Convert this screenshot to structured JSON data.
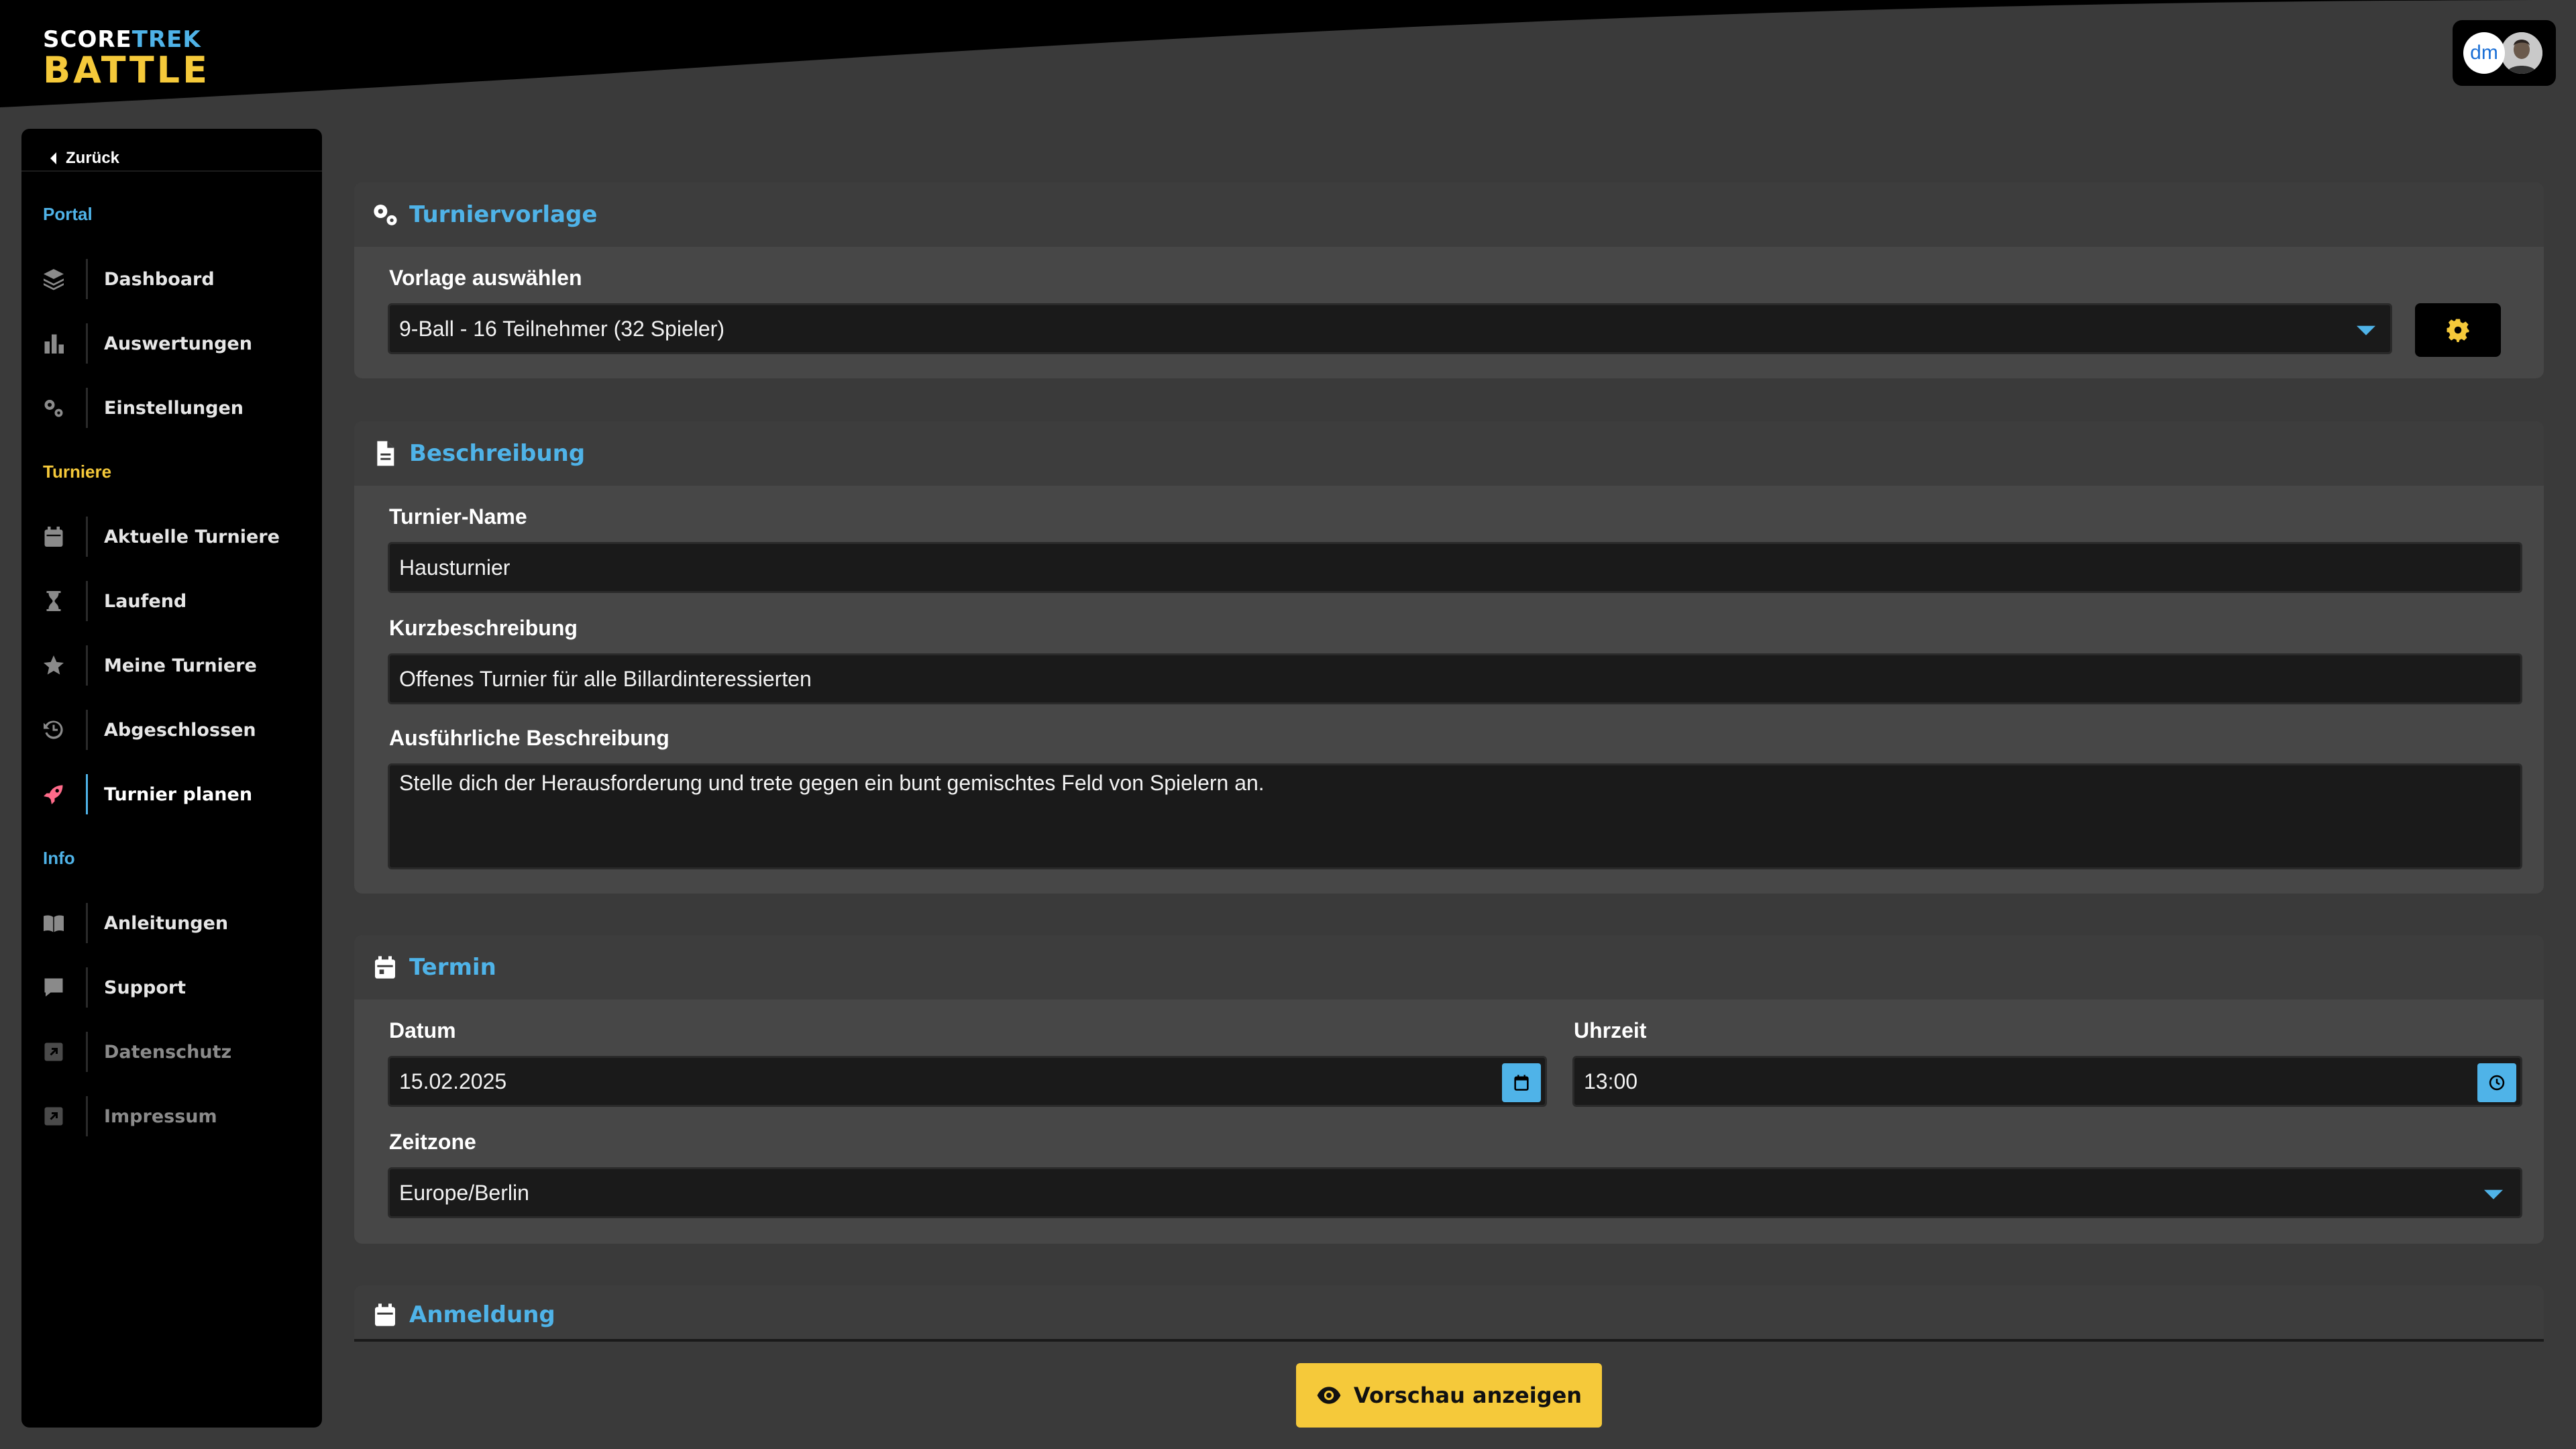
{
  "header": {
    "logo_top_white": "SCORE",
    "logo_top_blue": "TREK",
    "logo_bottom": "BATTLE",
    "brand_avatar_text": "dm"
  },
  "sidebar": {
    "back_label": "Zurück",
    "sections": [
      {
        "title": "Portal",
        "color": "#4fb3e8"
      },
      {
        "title": "Turniere",
        "color": "#f5c93a"
      },
      {
        "title": "Info",
        "color": "#4fb3e8"
      }
    ],
    "items": [
      {
        "label": "Dashboard",
        "icon": "layers-icon"
      },
      {
        "label": "Auswertungen",
        "icon": "bar-chart-icon"
      },
      {
        "label": "Einstellungen",
        "icon": "cogs-icon"
      },
      {
        "label": "Aktuelle Turniere",
        "icon": "calendar-icon"
      },
      {
        "label": "Laufend",
        "icon": "hourglass-icon"
      },
      {
        "label": "Meine Turniere",
        "icon": "star-icon"
      },
      {
        "label": "Abgeschlossen",
        "icon": "history-icon"
      },
      {
        "label": "Turnier planen",
        "icon": "rocket-icon",
        "active": true
      },
      {
        "label": "Anleitungen",
        "icon": "book-icon"
      },
      {
        "label": "Support",
        "icon": "comment-icon"
      },
      {
        "label": "Datenschutz",
        "icon": "external-link-icon"
      },
      {
        "label": "Impressum",
        "icon": "external-link-icon"
      }
    ]
  },
  "turniervorlage": {
    "title": "Turniervorlage",
    "select_label": "Vorlage auswählen",
    "select_value": "9-Ball - 16 Teilnehmer (32 Spieler)"
  },
  "beschreibung": {
    "title": "Beschreibung",
    "name_label": "Turnier-Name",
    "name_value": "Hausturnier",
    "short_label": "Kurzbeschreibung",
    "short_value": "Offenes Turnier für alle Billardinteressierten",
    "long_label": "Ausführliche Beschreibung",
    "long_value": "Stelle dich der Herausforderung und trete gegen ein bunt gemischtes Feld von Spielern an."
  },
  "termin": {
    "title": "Termin",
    "date_label": "Datum",
    "date_value": "15.02.2025",
    "time_label": "Uhrzeit",
    "time_value": "13:00",
    "tz_label": "Zeitzone",
    "tz_value": "Europe/Berlin"
  },
  "anmeldung": {
    "title": "Anmeldung"
  },
  "footer": {
    "preview_label": "Vorschau anzeigen"
  },
  "colors": {
    "accent_blue": "#4fb3e8",
    "accent_yellow": "#f5c93a",
    "active_icon": "#ff6b8a"
  }
}
